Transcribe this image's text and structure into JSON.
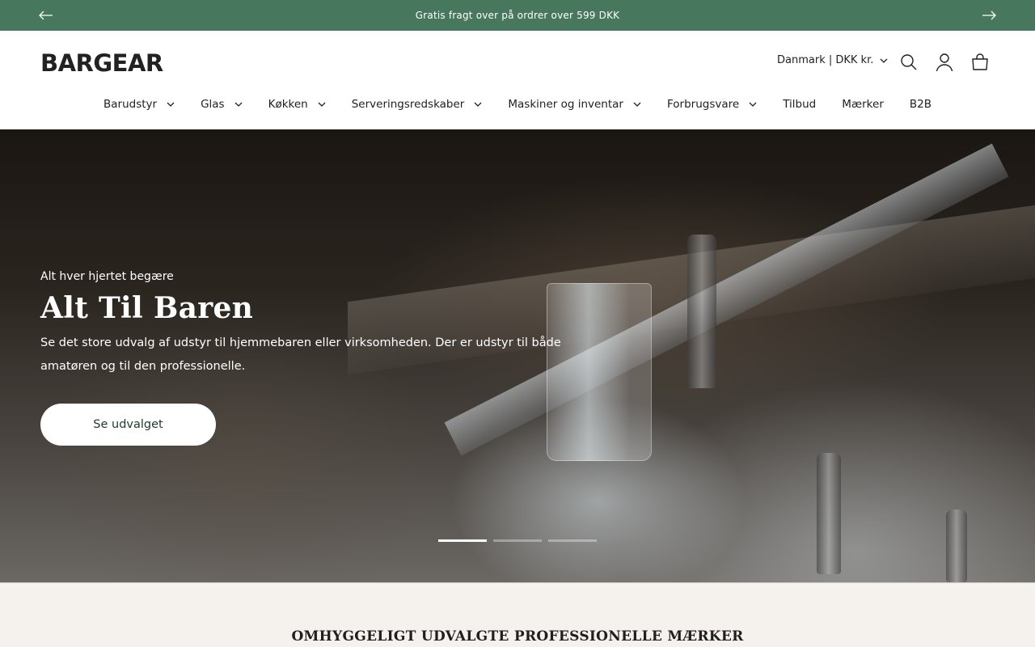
{
  "announcement": {
    "text": "Gratis fragt over på ordrer over 599 DKK",
    "prev_icon": "arrow-left-icon",
    "next_icon": "arrow-right-icon"
  },
  "header": {
    "logo": "BARGEAR",
    "locale": "Danmark | DKK kr.",
    "icons": [
      "search-icon",
      "account-icon",
      "cart-icon"
    ]
  },
  "nav": {
    "items": [
      {
        "label": "Barudstyr",
        "has_dropdown": true
      },
      {
        "label": "Glas",
        "has_dropdown": true
      },
      {
        "label": "Køkken",
        "has_dropdown": true
      },
      {
        "label": "Serveringsredskaber",
        "has_dropdown": true
      },
      {
        "label": "Maskiner og inventar",
        "has_dropdown": true
      },
      {
        "label": "Forbrugsvare",
        "has_dropdown": true
      },
      {
        "label": "Tilbud",
        "has_dropdown": false
      },
      {
        "label": "Mærker",
        "has_dropdown": false
      },
      {
        "label": "B2B",
        "has_dropdown": false
      }
    ]
  },
  "hero": {
    "subheading": "Alt hver hjertet begære",
    "title": "Alt Til Baren",
    "text": "Se det store udvalg af udstyr til hjemmebaren eller virksomheden. Der er udstyr til både amatøren og til den professionelle.",
    "button_label": "Se udvalget",
    "slides_total": 3,
    "active_slide": 1
  },
  "brands": {
    "title": "OMHYGGELIGT UDVALGTE PROFESSIONELLE MÆRKER"
  },
  "colors": {
    "announcement_bg": "#47785d",
    "brand_section_bg": "#f5f1ec",
    "button_text": "#1f3a2c"
  }
}
